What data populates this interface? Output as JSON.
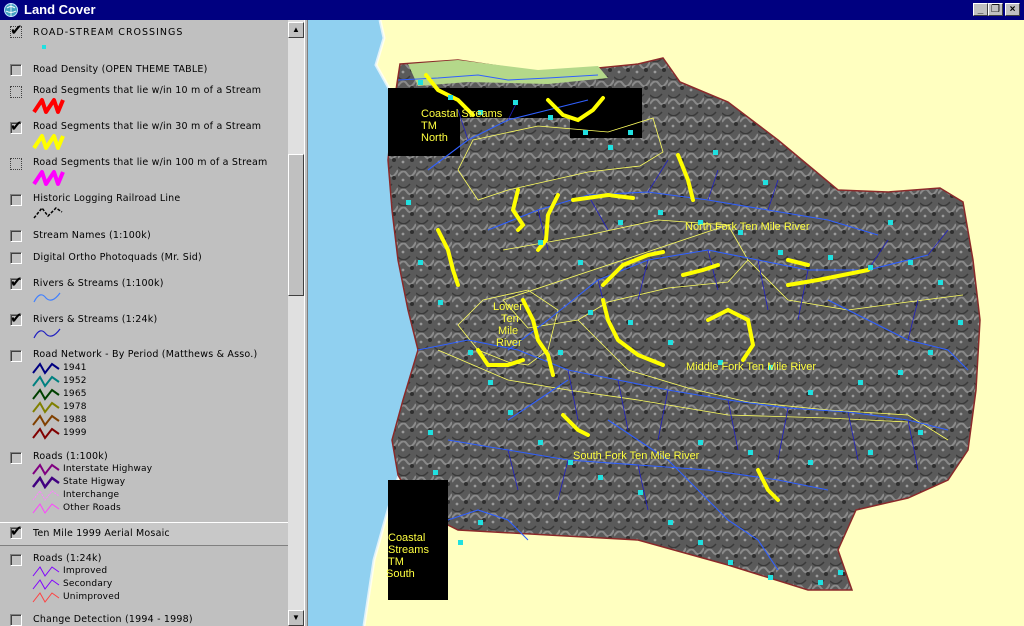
{
  "window": {
    "title": "Land Cover",
    "minimize_glyph": "_",
    "maximize_glyph": "❐",
    "close_glyph": "×"
  },
  "scrollbar": {
    "up_glyph": "▲",
    "down_glyph": "▼"
  },
  "toc": {
    "layers": [
      {
        "label": "ROAD-STREAM CROSSINGS",
        "checked": true
      },
      {
        "label": "Road Density (OPEN THEME TABLE)",
        "checked": false
      },
      {
        "label": "Road Segments that lie w/in 10 m of a Stream",
        "checked": false,
        "symbol_color": "#ff0000"
      },
      {
        "label": "Road Segments that lie w/in 30 m of a Stream",
        "checked": true,
        "symbol_color": "#ffff00"
      },
      {
        "label": "Road Segments that lie w/in 100 m of a Stream",
        "checked": false,
        "symbol_color": "#ff00ff"
      },
      {
        "label": "Historic Logging Railroad Line",
        "checked": false
      },
      {
        "label": "Stream Names (1:100k)",
        "checked": false
      },
      {
        "label": "Digital Ortho Photoquads (Mr. Sid)",
        "checked": false
      },
      {
        "label": "Rivers & Streams (1:100k)",
        "checked": true,
        "symbol_color": "#4080ff"
      },
      {
        "label": "Rivers & Streams (1:24k)",
        "checked": true,
        "symbol_color": "#2020c0"
      },
      {
        "label": "Road Network - By Period (Matthews & Asso.)",
        "checked": false
      },
      {
        "label": "Roads (1:100k)",
        "checked": false
      },
      {
        "label": "Ten Mile 1999 Aerial Mosaic",
        "checked": true
      },
      {
        "label": "Roads (1:24k)",
        "checked": false
      },
      {
        "label": "Change Detection (1994 - 1998)",
        "checked": false
      }
    ],
    "road_periods": [
      {
        "label": "1941",
        "color": "#000080"
      },
      {
        "label": "1952",
        "color": "#008080"
      },
      {
        "label": "1965",
        "color": "#004000"
      },
      {
        "label": "1978",
        "color": "#808000"
      },
      {
        "label": "1988",
        "color": "#804000"
      },
      {
        "label": "1999",
        "color": "#800000"
      }
    ],
    "roads_100k": [
      {
        "label": "Interstate Highway",
        "color": "#800080"
      },
      {
        "label": "State Higway",
        "color": "#400080"
      },
      {
        "label": "Interchange",
        "color": "#ff80ff"
      },
      {
        "label": "Other Roads",
        "color": "#ff40ff"
      }
    ],
    "roads_24k": [
      {
        "label": "Improved",
        "color": "#8000ff"
      },
      {
        "label": "Secondary",
        "color": "#8000ff"
      },
      {
        "label": "Unimproved",
        "color": "#ff4040"
      }
    ]
  },
  "map": {
    "labels": {
      "coastal_north_1": "Coastal Streams",
      "coastal_north_2": "TM",
      "coastal_north_3": "North",
      "north_fork": "North Fork Ten Mile River",
      "lower_1": "Lower",
      "lower_2": "Ten",
      "lower_3": "Mile",
      "lower_4": "River",
      "middle_fork": "Middle Fork Ten Mile River",
      "south_fork": "South Fork Ten Mile River",
      "coastal_south_1": "Coastal",
      "coastal_south_2": "Streams",
      "coastal_south_3": "TM",
      "coastal_south_4": "South"
    },
    "colors": {
      "ocean": "#90d0f0",
      "land_background": "#ffffc0",
      "crossing_points": "#20e0e0",
      "roads_30m": "#ffff00",
      "streams": "#3060ff",
      "watershed_boundary": "#ffff60"
    }
  }
}
